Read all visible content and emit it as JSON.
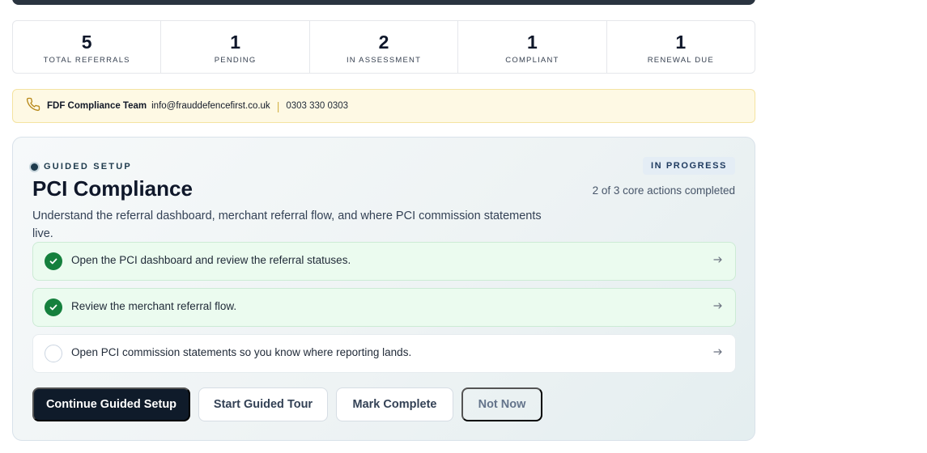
{
  "stats": [
    {
      "value": "5",
      "label": "Total Referrals"
    },
    {
      "value": "1",
      "label": "Pending"
    },
    {
      "value": "2",
      "label": "In Assessment"
    },
    {
      "value": "1",
      "label": "Compliant"
    },
    {
      "value": "1",
      "label": "Renewal Due"
    }
  ],
  "contact": {
    "icon": "phone-icon",
    "team": "FDF Compliance Team",
    "email": "info@frauddefencefirst.co.uk",
    "separator": "|",
    "phone": "0303 330 0303"
  },
  "setup": {
    "eyebrow": "Guided Setup",
    "title": "PCI Compliance",
    "description": "Understand the referral dashboard, merchant referral flow, and where PCI commission statements live.",
    "status_badge": "In Progress",
    "progress_text": "2 of 3 core actions completed",
    "tasks": [
      {
        "label": "Open the PCI dashboard and review the referral statuses.",
        "done": true
      },
      {
        "label": "Review the merchant referral flow.",
        "done": true
      },
      {
        "label": "Open PCI commission statements so you know where reporting lands.",
        "done": false
      }
    ],
    "buttons": {
      "continue": "Continue Guided Setup",
      "tour": "Start Guided Tour",
      "mark_complete": "Mark Complete",
      "not_now": "Not Now"
    }
  },
  "colors": {
    "primary_button": "#0f1b2a",
    "success": "#15803d",
    "contact_bg": "#fef9e4"
  }
}
